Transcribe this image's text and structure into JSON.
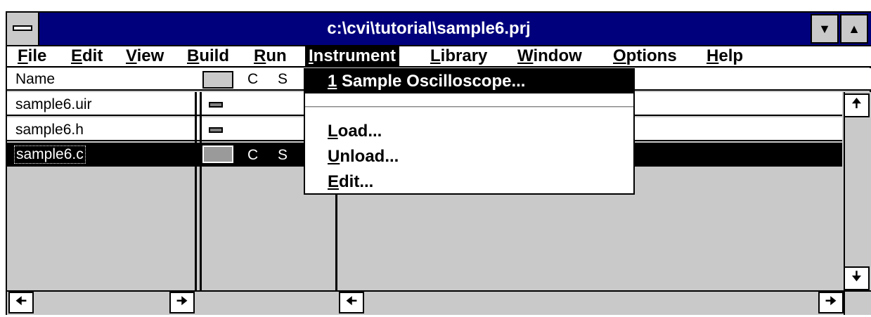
{
  "window": {
    "title": "c:\\cvi\\tutorial\\sample6.prj"
  },
  "menubar": {
    "items": [
      {
        "ul": "F",
        "rest": "ile"
      },
      {
        "ul": "E",
        "rest": "dit"
      },
      {
        "ul": "V",
        "rest": "iew"
      },
      {
        "ul": "B",
        "rest": "uild"
      },
      {
        "ul": "R",
        "rest": "un"
      },
      {
        "ul": "I",
        "rest": "nstrument"
      },
      {
        "ul": "L",
        "rest": "ibrary"
      },
      {
        "ul": "W",
        "rest": "indow"
      },
      {
        "ul": "O",
        "rest": "ptions"
      },
      {
        "ul": "H",
        "rest": "elp"
      }
    ]
  },
  "header": {
    "name": "Name",
    "c": "C",
    "s": "S"
  },
  "files": [
    {
      "name": "sample6.uir"
    },
    {
      "name": "sample6.h"
    },
    {
      "name": "sample6.c",
      "c": "C",
      "s": "S"
    }
  ],
  "dropdown": {
    "recent": {
      "ul": "1",
      "rest": " Sample Oscilloscope..."
    },
    "load": {
      "ul": "L",
      "rest": "oad..."
    },
    "unload": {
      "ul": "U",
      "rest": "nload..."
    },
    "edit": {
      "ul": "E",
      "rest": "dit..."
    }
  },
  "icons": {
    "up": "▲",
    "down": "▼",
    "arrow_up": "🠉",
    "arrow_left": "🠈",
    "arrow_right": "🠊",
    "arrow_down": "🠋"
  },
  "colors": {
    "titlebar": "#00007c",
    "face": "#c9c9c9",
    "selection": "#000000"
  }
}
